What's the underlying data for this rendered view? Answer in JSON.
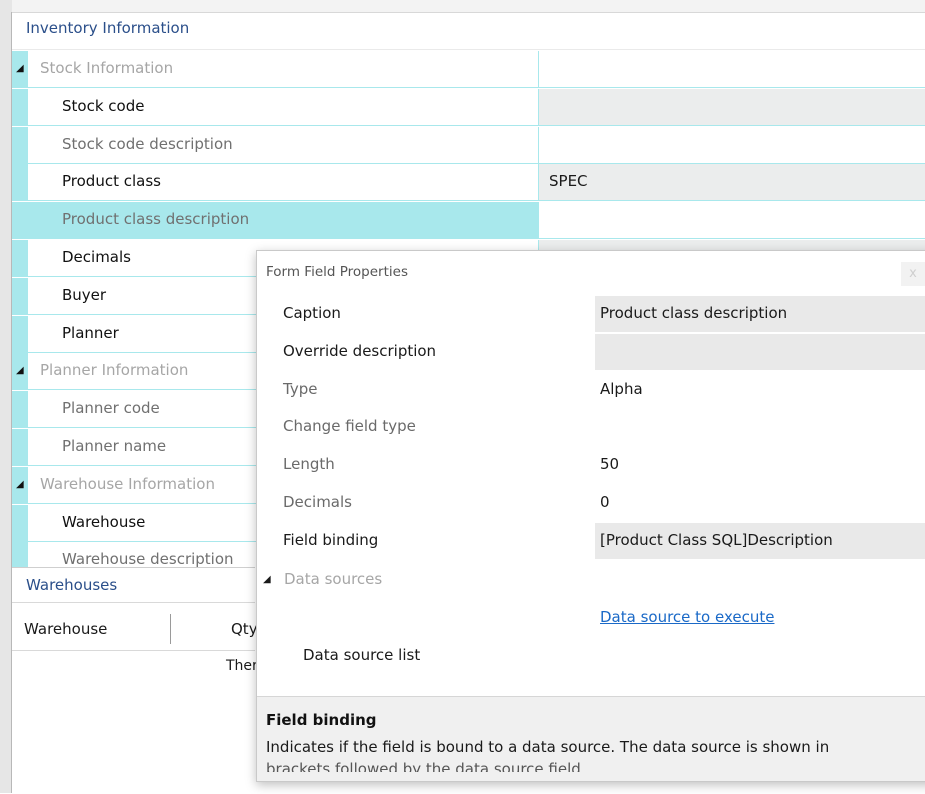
{
  "inventory": {
    "title": "Inventory Information",
    "rows": [
      {
        "kind": "category",
        "label": "Stock Information"
      },
      {
        "kind": "field",
        "label": "Stock code",
        "style": "bold",
        "value": "",
        "value_bg": "grey"
      },
      {
        "kind": "field",
        "label": "Stock code description",
        "style": "dim",
        "value": "",
        "value_bg": "white"
      },
      {
        "kind": "field",
        "label": "Product class",
        "style": "bold",
        "value": "SPEC",
        "value_bg": "grey"
      },
      {
        "kind": "field",
        "label": "Product class description",
        "style": "dim",
        "value": "",
        "value_bg": "white",
        "selected": true
      },
      {
        "kind": "field",
        "label": "Decimals",
        "style": "bold",
        "value": "",
        "value_bg": "grey"
      },
      {
        "kind": "field",
        "label": "Buyer",
        "style": "bold",
        "value": "",
        "value_bg": "grey"
      },
      {
        "kind": "field",
        "label": "Planner",
        "style": "bold",
        "value": "",
        "value_bg": "grey"
      },
      {
        "kind": "category",
        "label": "Planner Information"
      },
      {
        "kind": "field",
        "label": "Planner code",
        "style": "dim",
        "value": "",
        "value_bg": "white"
      },
      {
        "kind": "field",
        "label": "Planner name",
        "style": "dim",
        "value": "",
        "value_bg": "white"
      },
      {
        "kind": "category",
        "label": "Warehouse Information"
      },
      {
        "kind": "field",
        "label": "Warehouse",
        "style": "bold",
        "value": "",
        "value_bg": "grey"
      },
      {
        "kind": "field",
        "label": "Warehouse description",
        "style": "dim",
        "value": "",
        "value_bg": "white"
      }
    ]
  },
  "warehouses": {
    "title": "Warehouses",
    "col1": "Warehouse",
    "col2": "Qty",
    "message": "Ther"
  },
  "popup": {
    "title": "Form Field Properties",
    "close_label": "x",
    "rows": [
      {
        "label": "Caption",
        "style": "bold",
        "value": "Product class description",
        "value_bg": "grey"
      },
      {
        "label": "Override description",
        "style": "bold",
        "value": "",
        "value_bg": "grey"
      },
      {
        "label": "Type",
        "style": "dim",
        "value": "Alpha",
        "value_bg": "white"
      },
      {
        "label": "Change field type",
        "style": "dim",
        "value": "",
        "value_bg": "white"
      },
      {
        "label": "Length",
        "style": "dim",
        "value": "50",
        "value_bg": "white"
      },
      {
        "label": "Decimals",
        "style": "dim",
        "value": "0",
        "value_bg": "white"
      },
      {
        "label": "Field binding",
        "style": "bold",
        "value": "[Product Class SQL]Description",
        "value_bg": "grey"
      }
    ],
    "data_sources": {
      "category": "Data sources",
      "link": "Data source to execute",
      "list_label": "Data source list"
    },
    "help": {
      "title": "Field binding",
      "text": "Indicates if the field is bound to a data source. The data source is shown in",
      "text_cut": "brackets followed by the data source field"
    }
  },
  "colors": {
    "accent_teal": "#a8e8ec",
    "header_blue": "#2b4f8a",
    "link_blue": "#1a69c7"
  }
}
